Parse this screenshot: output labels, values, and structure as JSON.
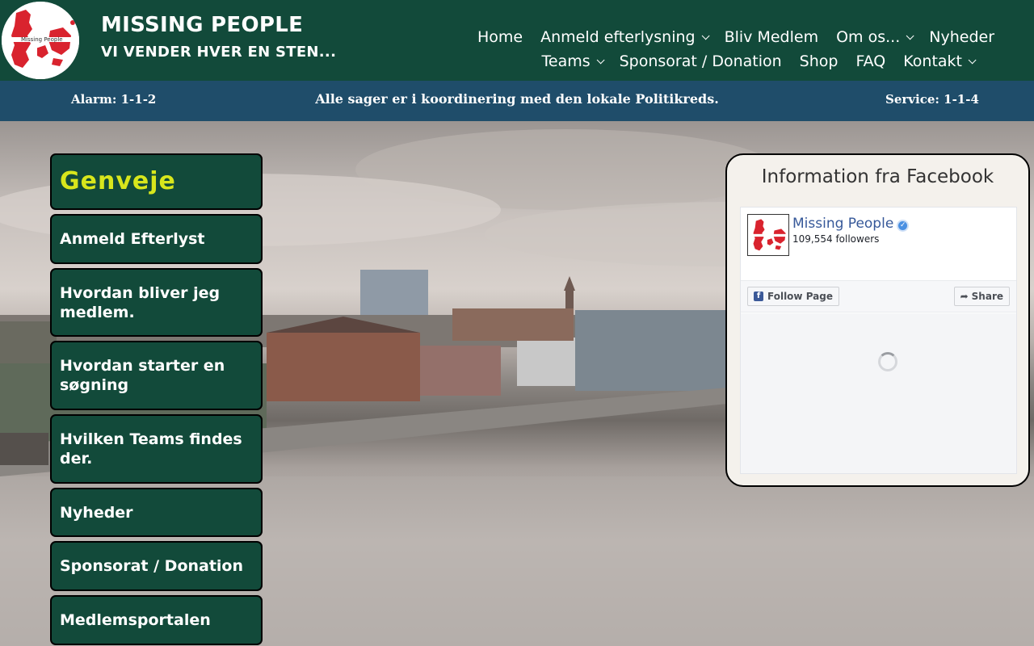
{
  "header": {
    "site_title": "MISSING PEOPLE",
    "tagline": "VI VENDER HVER EN STEN...",
    "logo_text": "Missing People"
  },
  "nav": {
    "row1": [
      {
        "label": "Home",
        "dropdown": false
      },
      {
        "label": "Anmeld efterlysning",
        "dropdown": true
      },
      {
        "label": "Bliv Medlem",
        "dropdown": false
      },
      {
        "label": "Om os...",
        "dropdown": true
      },
      {
        "label": "Nyheder",
        "dropdown": false
      }
    ],
    "row2": [
      {
        "label": "Teams",
        "dropdown": true
      },
      {
        "label": "Sponsorat / Donation",
        "dropdown": false
      },
      {
        "label": "Shop",
        "dropdown": false
      },
      {
        "label": "FAQ",
        "dropdown": false
      },
      {
        "label": "Kontakt",
        "dropdown": true
      }
    ]
  },
  "infobar": {
    "left": "Alarm: 1-1-2",
    "center": "Alle sager er i koordinering med den lokale Politikreds.",
    "right": "Service: 1-1-4"
  },
  "shortcuts": {
    "title": "Genveje",
    "items": [
      "Anmeld Efterlyst",
      "Hvordan bliver jeg medlem.",
      "Hvordan starter en søgning",
      "Hvilken Teams findes der.",
      "Nyheder",
      "Sponsorat / Donation",
      "Medlemsportalen"
    ]
  },
  "facebook": {
    "panel_title": "Information fra Facebook",
    "page_name": "Missing People",
    "followers": "109,554 followers",
    "follow_label": "Follow Page",
    "share_label": "Share",
    "fb_letter": "f"
  },
  "colors": {
    "header_green": "#124a3a",
    "infobar_blue": "#1f4d6a",
    "shortcut_title": "#d8e61c",
    "fb_link": "#365899",
    "logo_red": "#d9232e"
  }
}
